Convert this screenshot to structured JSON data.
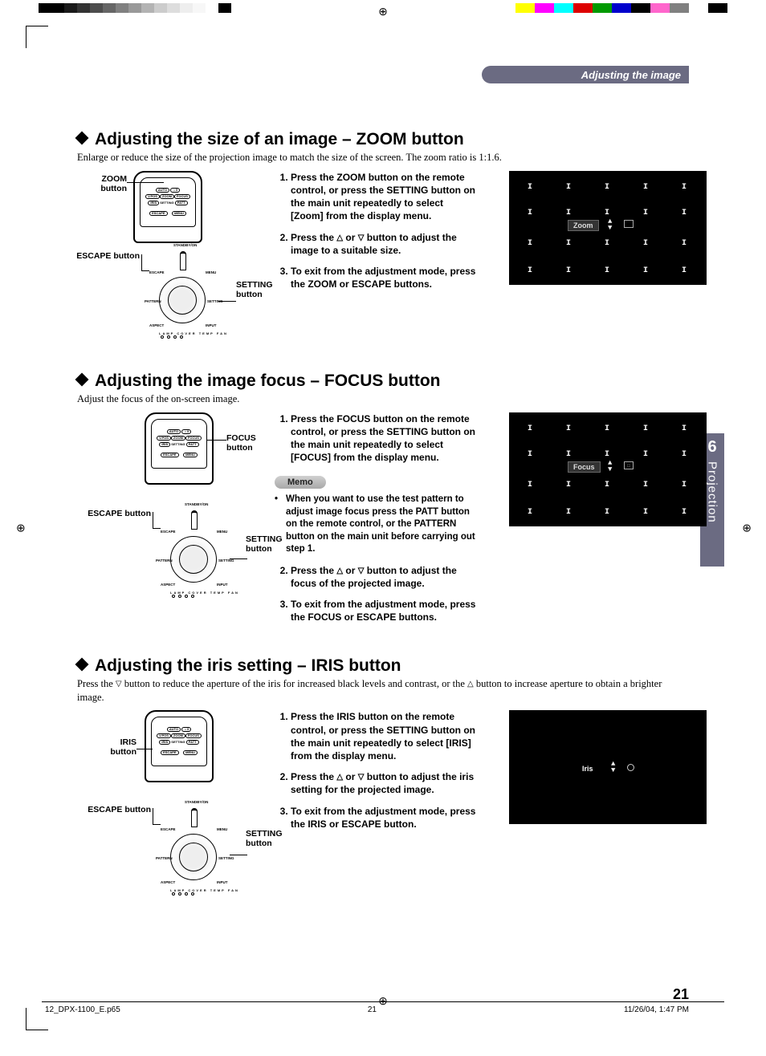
{
  "header": {
    "title": "Adjusting the image"
  },
  "side_tab": {
    "num": "6",
    "label": "Projection"
  },
  "page_number": "21",
  "footer": {
    "file": "12_DPX-1100_E.p65",
    "page": "21",
    "date": "11/26/04, 1:47 PM"
  },
  "sections": {
    "zoom": {
      "title": "Adjusting the size of an image – ZOOM button",
      "sub": "Enlarge or reduce the size of the projection image to match the size of the screen. The zoom ratio is 1:1.6.",
      "step1": "Press the ZOOM button on the remote control, or press the SETTING button on the main unit repeatedly to select [Zoom] from the display menu.",
      "step2a": "Press the ",
      "step2b": " or ",
      "step2c": " button to adjust the image to a suitable size.",
      "step3": "To exit from the adjustment mode, press the ZOOM or ESCAPE buttons.",
      "callouts": {
        "zoom": "ZOOM\nbutton",
        "escape": "ESCAPE button",
        "setting": "SETTING\nbutton"
      },
      "osd_label": "Zoom"
    },
    "focus": {
      "title": "Adjusting the image focus – FOCUS button",
      "sub": "Adjust the focus of the on-screen image.",
      "step1": "Press the FOCUS button on the remote control, or press the SETTING button on the main unit repeatedly to select [FOCUS] from the display menu.",
      "memo_label": "Memo",
      "memo": "When you want to use the test pattern to adjust image focus press the PATT button on the remote control, or the PATTERN button on the main unit before carrying out step 1.",
      "step2a": "Press the ",
      "step2b": " or ",
      "step2c": " button to adjust the  focus of the projected image.",
      "step3": "To exit from the adjustment mode, press the FOCUS or ESCAPE buttons.",
      "callouts": {
        "focus": "FOCUS\nbutton",
        "escape": "ESCAPE button",
        "setting": "SETTING\nbutton"
      },
      "osd_label": "Focus"
    },
    "iris": {
      "title": "Adjusting the iris setting – IRIS button",
      "sub_a": "Press the ",
      "sub_b": " button to reduce the aperture of the iris for increased black levels and contrast, or the ",
      "sub_c": " button to increase aperture to obtain a brighter image.",
      "step1": "Press the IRIS button on the remote control, or press the SETTING button on the main unit repeatedly to select [IRIS] from the display menu.",
      "step2a": " Press the ",
      "step2b": " or ",
      "step2c": " button to adjust the  iris setting for the projected image.",
      "step3": "To exit from the adjustment mode, press the IRIS or ESCAPE button.",
      "callouts": {
        "iris": "IRIS\nbutton",
        "escape": "ESCAPE button",
        "setting": "SETTING\nbutton"
      },
      "osd_label": "Iris"
    }
  },
  "remote_labels": {
    "auto": "AUTO",
    "light": "☼/ⅰ",
    "vpos": "V.POS",
    "zoom": "ZOOM",
    "focus": "FOCUS",
    "iris": "IRIS",
    "setting": "SETTING",
    "patt": "PATT",
    "escape": "ESCAPE",
    "menu": "MENU",
    "standby": "STANDBY/ON"
  },
  "mu_labels": {
    "escape": "ESCAPE",
    "menu": "MENU",
    "pattern": "PATTERN",
    "setting": "SETTING",
    "aspect": "ASPECT",
    "input": "INPUT",
    "leds": "LAMP  COVER  TEMP  FAN"
  },
  "color_strip": [
    "#ffff00",
    "#ff00ff",
    "#00ffff",
    "#dd0000",
    "#009900",
    "#0000cc",
    "#000000",
    "#ff66cc",
    "#808080",
    "#ffffff",
    "#000000"
  ],
  "bw_strip": [
    "#000",
    "#000",
    "#1a1a1a",
    "#333",
    "#4d4d4d",
    "#666",
    "#808080",
    "#999",
    "#b3b3b3",
    "#ccc",
    "#ddd",
    "#eee",
    "#f7f7f7",
    "#fff",
    "#000"
  ]
}
